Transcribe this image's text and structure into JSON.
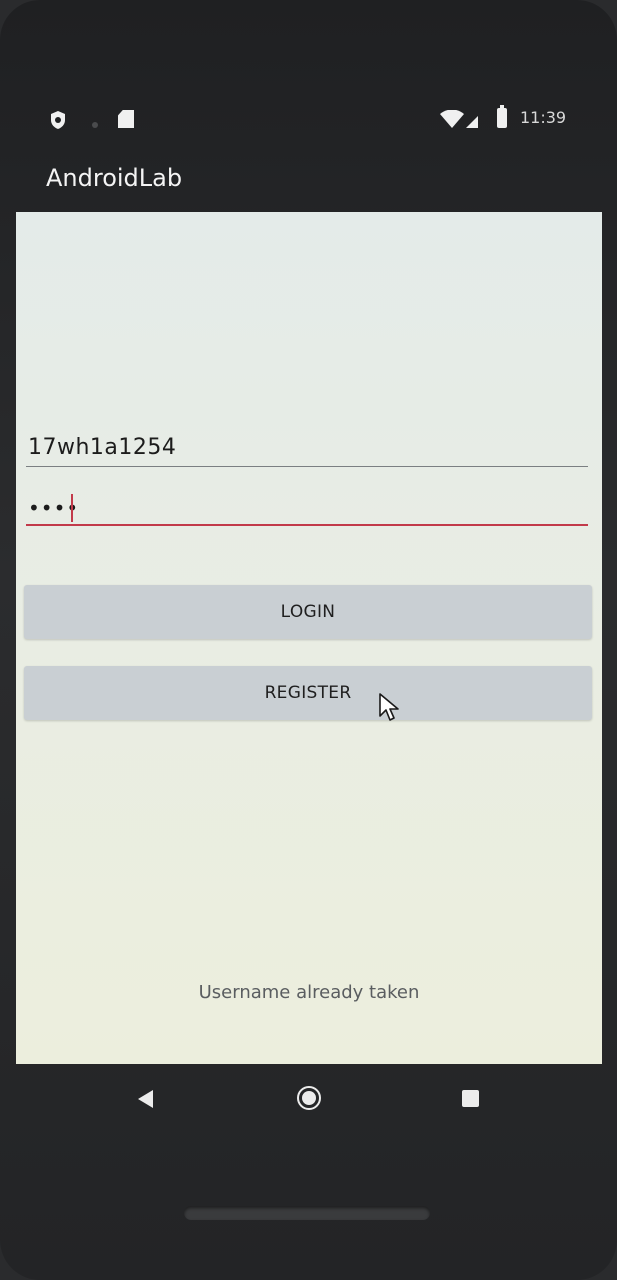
{
  "status_bar": {
    "time": "11:39",
    "icons": [
      "shield-icon",
      "notification-dot-icon",
      "sd-card-icon",
      "wifi-icon",
      "signal-icon",
      "battery-icon"
    ]
  },
  "app_bar": {
    "title": "AndroidLab"
  },
  "form": {
    "username_value": "17wh1a1254",
    "password_masked": "••••",
    "login_label": "LOGIN",
    "register_label": "REGISTER"
  },
  "toast": {
    "message": "Username already taken"
  },
  "nav_bar": {
    "icons": [
      "back-icon",
      "home-icon",
      "recents-icon"
    ]
  },
  "colors": {
    "accent": "#c23a4a",
    "button_bg": "#c9cfd3",
    "screen_bg": "#e9ede3",
    "frame": "#2a2b2d"
  }
}
